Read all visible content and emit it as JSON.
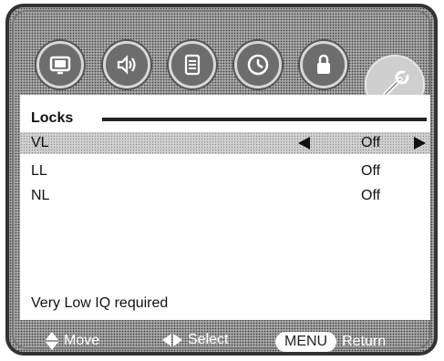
{
  "icons": {
    "tabs": [
      {
        "name": "picture-icon"
      },
      {
        "name": "sound-icon"
      },
      {
        "name": "setup-icon"
      },
      {
        "name": "clock-icon"
      },
      {
        "name": "lock-icon"
      },
      {
        "name": "tools-icon",
        "active": true
      }
    ]
  },
  "panel": {
    "title": "Locks",
    "rows": [
      {
        "label": "VL",
        "value": "Off",
        "selected": true
      },
      {
        "label": "LL",
        "value": "Off",
        "selected": false
      },
      {
        "label": "NL",
        "value": "Off",
        "selected": false
      }
    ],
    "hint": "Very Low IQ required"
  },
  "footer": {
    "move_label": "Move",
    "select_label": "Select",
    "menu_key": "MENU",
    "return_label": "Return"
  }
}
